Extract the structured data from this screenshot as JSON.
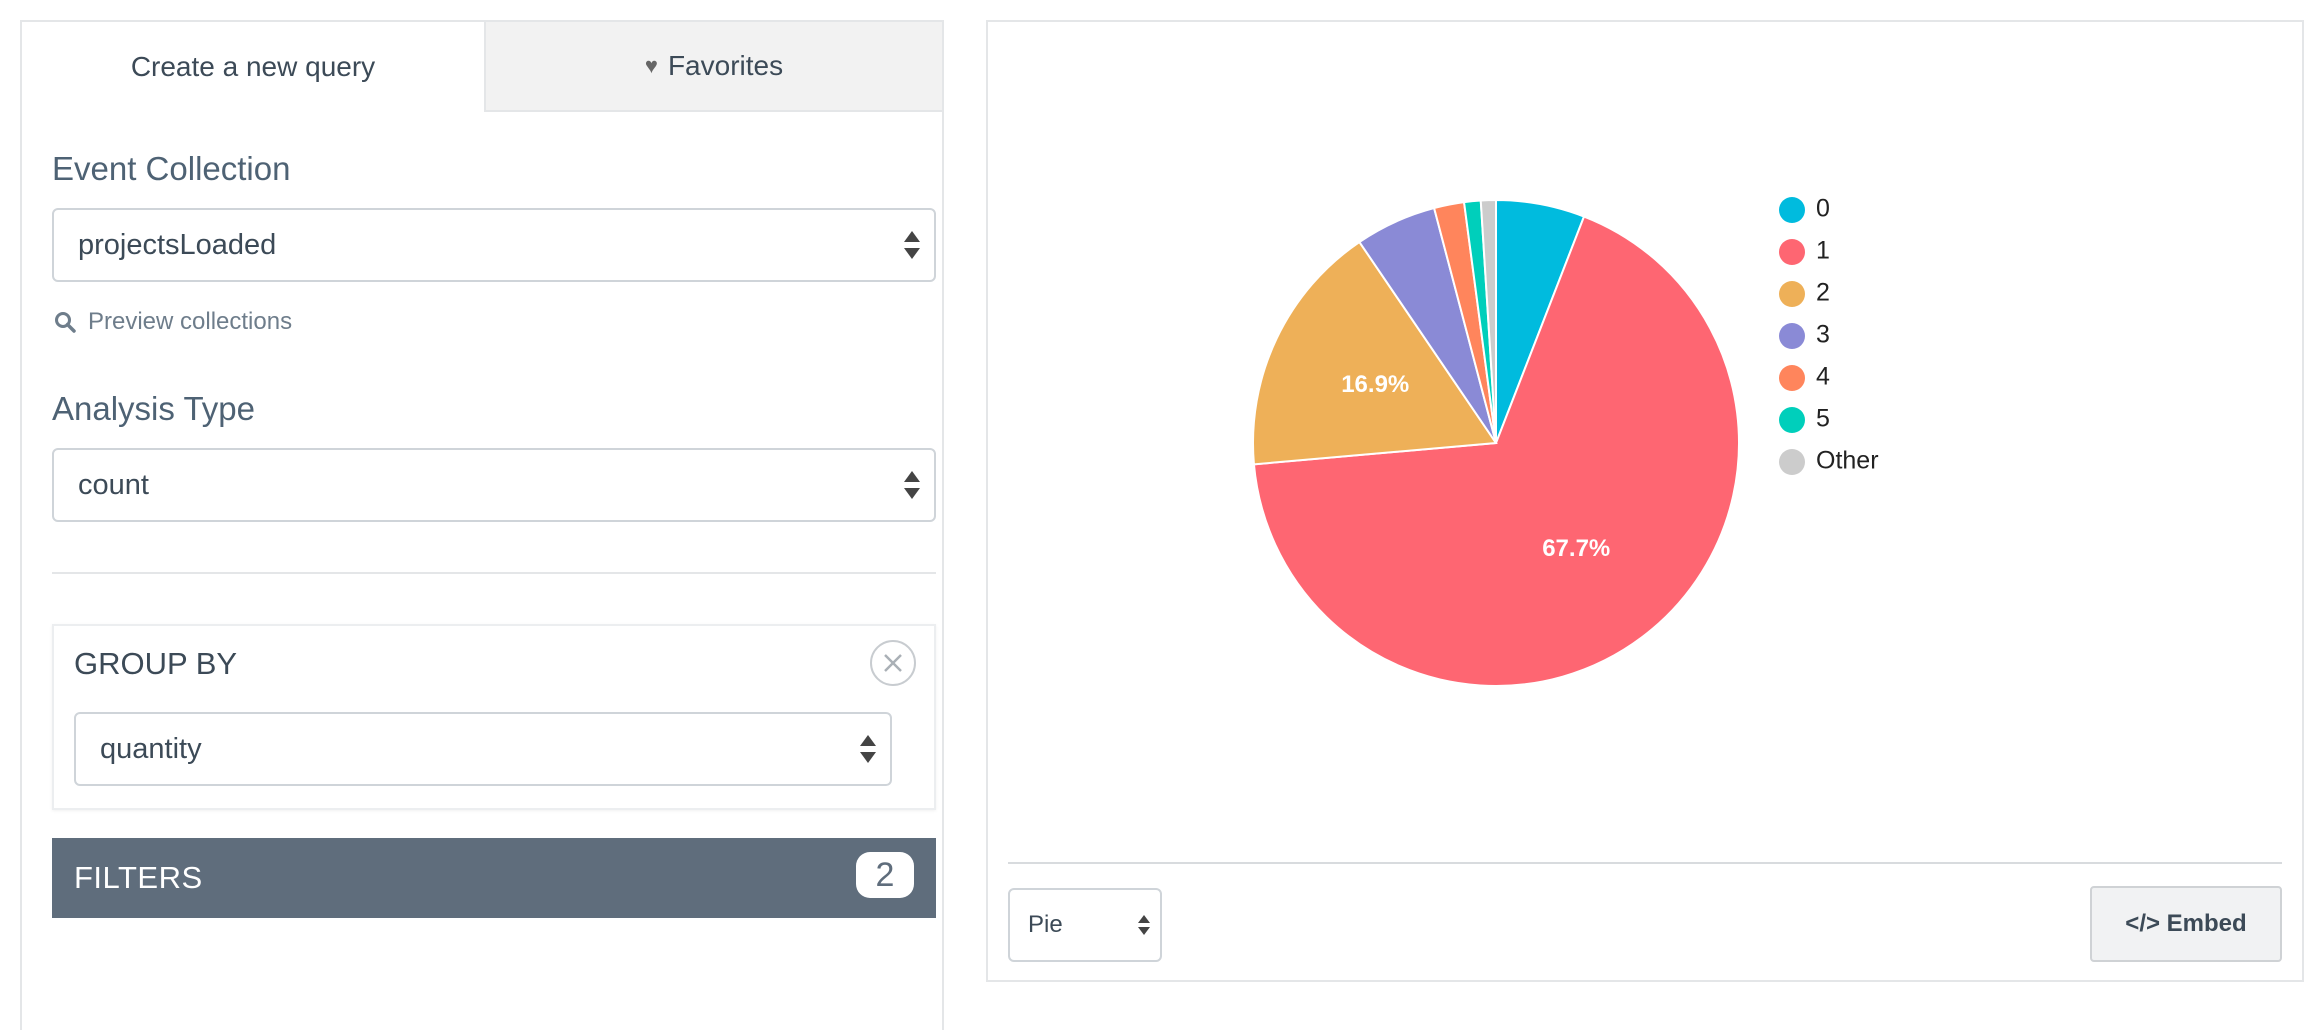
{
  "tabs": {
    "new_query": "Create a new query",
    "favorites": "Favorites"
  },
  "event_collection": {
    "label": "Event Collection",
    "value": "projectsLoaded",
    "preview_link": "Preview collections"
  },
  "analysis_type": {
    "label": "Analysis Type",
    "value": "count"
  },
  "group_by": {
    "title": "GROUP BY",
    "value": "quantity"
  },
  "filters": {
    "label": "FILTERS",
    "count": "2"
  },
  "chart_controls": {
    "type_value": "Pie",
    "embed_label": "</> Embed"
  },
  "colors": {
    "filters_bar": "#5f6d7c",
    "accent": "#00bbde"
  },
  "chart_data": {
    "type": "pie",
    "slices": [
      {
        "label": "0",
        "value": 5.9,
        "color": "#00bbde"
      },
      {
        "label": "1",
        "value": 67.7,
        "color": "#fe6672",
        "display": "67.7%"
      },
      {
        "label": "2",
        "value": 16.9,
        "color": "#eeb058",
        "display": "16.9%"
      },
      {
        "label": "3",
        "value": 5.4,
        "color": "#8a8ad6"
      },
      {
        "label": "4",
        "value": 2.0,
        "color": "#ff855c"
      },
      {
        "label": "5",
        "value": 1.1,
        "color": "#00cfbb"
      },
      {
        "label": "Other",
        "value": 1.0,
        "color": "#cccccc"
      }
    ],
    "legend_position": "right"
  }
}
